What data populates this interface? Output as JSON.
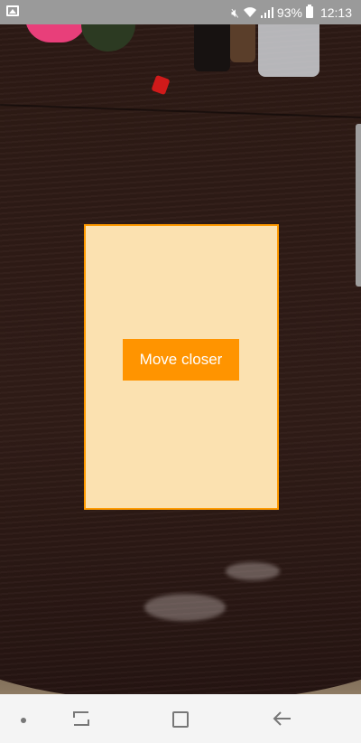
{
  "status_bar": {
    "battery": "93%",
    "time": "12:13",
    "icons": [
      "gallery-icon",
      "mute-icon",
      "wifi-icon",
      "signal-icon",
      "battery-icon"
    ]
  },
  "scanner": {
    "hint": "Move closer",
    "document_outline_color": "#ff9a00",
    "hint_background": "#ff9400"
  },
  "nav_bar": {
    "icons": [
      "menu-dot-icon",
      "recents-icon",
      "home-icon",
      "back-icon"
    ]
  }
}
